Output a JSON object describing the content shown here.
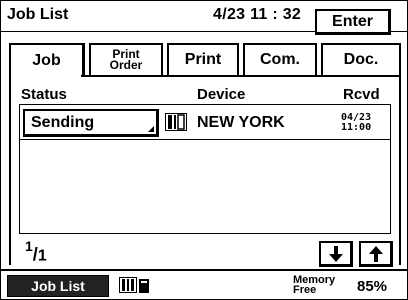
{
  "header": {
    "title": "Job List",
    "datetime": "4/23 11 : 32",
    "enter_label": "Enter"
  },
  "tabs": [
    {
      "label": "Job",
      "active": true
    },
    {
      "label_line1": "Print",
      "label_line2": "Order",
      "active": false
    },
    {
      "label": "Print",
      "active": false
    },
    {
      "label": "Com.",
      "active": false
    },
    {
      "label": "Doc.",
      "active": false
    }
  ],
  "columns": {
    "status": "Status",
    "device": "Device",
    "rcvd": "Rcvd"
  },
  "rows": [
    {
      "status": "Sending",
      "device_icon": "fax-machine-icon",
      "device": "NEW YORK",
      "rcvd_date": "04/23",
      "rcvd_time": "11:00"
    }
  ],
  "pager": {
    "current": "1",
    "total": "1"
  },
  "statusbar": {
    "job_list_label": "Job List",
    "memory_label_line1": "Memory",
    "memory_label_line2": "Free",
    "memory_value": "85%"
  }
}
